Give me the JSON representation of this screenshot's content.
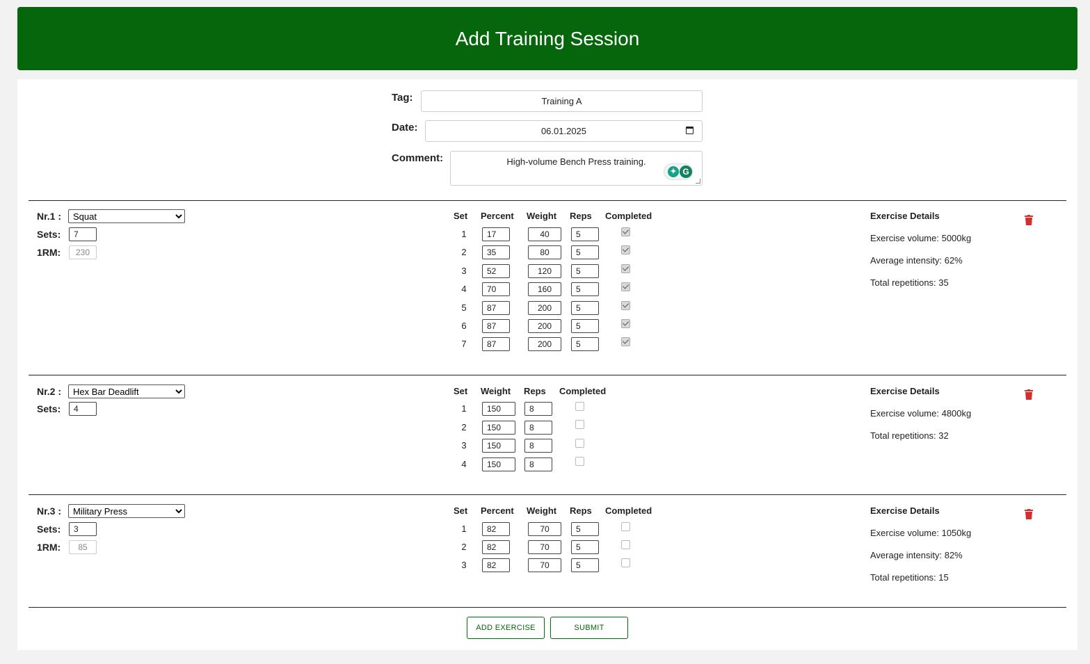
{
  "header": {
    "title": "Add Training Session"
  },
  "form": {
    "tag_label": "Tag:",
    "tag_value": "Training A",
    "date_label": "Date:",
    "date_value": "06.01.2025",
    "comment_label": "Comment:",
    "comment_value": "High-volume Bench Press training."
  },
  "exercises": [
    {
      "nr_label": "Nr.1 :",
      "name": "Squat",
      "sets_label": "Sets:",
      "sets": "7",
      "orm_label": "1RM:",
      "orm": "230",
      "headers": [
        "Set",
        "Percent",
        "Weight",
        "Reps",
        "Completed"
      ],
      "rows": [
        {
          "set": "1",
          "percent": "17",
          "weight": "40",
          "reps": "5",
          "completed": true
        },
        {
          "set": "2",
          "percent": "35",
          "weight": "80",
          "reps": "5",
          "completed": true
        },
        {
          "set": "3",
          "percent": "52",
          "weight": "120",
          "reps": "5",
          "completed": true
        },
        {
          "set": "4",
          "percent": "70",
          "weight": "160",
          "reps": "5",
          "completed": true
        },
        {
          "set": "5",
          "percent": "87",
          "weight": "200",
          "reps": "5",
          "completed": true
        },
        {
          "set": "6",
          "percent": "87",
          "weight": "200",
          "reps": "5",
          "completed": true
        },
        {
          "set": "7",
          "percent": "87",
          "weight": "200",
          "reps": "5",
          "completed": true
        }
      ],
      "details_title": "Exercise Details",
      "details": [
        "Exercise volume: 5000kg",
        "Average intensity: 62%",
        "Total repetitions: 35"
      ]
    },
    {
      "nr_label": "Nr.2 :",
      "name": "Hex Bar Deadlift",
      "sets_label": "Sets:",
      "sets": "4",
      "headers": [
        "Set",
        "Weight",
        "Reps",
        "Completed"
      ],
      "rows": [
        {
          "set": "1",
          "weight": "150",
          "reps": "8",
          "completed": false
        },
        {
          "set": "2",
          "weight": "150",
          "reps": "8",
          "completed": false
        },
        {
          "set": "3",
          "weight": "150",
          "reps": "8",
          "completed": false
        },
        {
          "set": "4",
          "weight": "150",
          "reps": "8",
          "completed": false
        }
      ],
      "details_title": "Exercise Details",
      "details": [
        "Exercise volume: 4800kg",
        "Total repetitions: 32"
      ]
    },
    {
      "nr_label": "Nr.3 :",
      "name": "Military Press",
      "sets_label": "Sets:",
      "sets": "3",
      "orm_label": "1RM:",
      "orm": "85",
      "headers": [
        "Set",
        "Percent",
        "Weight",
        "Reps",
        "Completed"
      ],
      "rows": [
        {
          "set": "1",
          "percent": "82",
          "weight": "70",
          "reps": "5",
          "completed": false
        },
        {
          "set": "2",
          "percent": "82",
          "weight": "70",
          "reps": "5",
          "completed": false
        },
        {
          "set": "3",
          "percent": "82",
          "weight": "70",
          "reps": "5",
          "completed": false
        }
      ],
      "details_title": "Exercise Details",
      "details": [
        "Exercise volume: 1050kg",
        "Average intensity: 82%",
        "Total repetitions: 15"
      ]
    }
  ],
  "actions": {
    "add_label": "ADD EXERCISE",
    "submit_label": "SUBMIT"
  },
  "colors": {
    "header_bg": "#05660b",
    "accent": "#05660b",
    "delete": "#d32f2f"
  },
  "icons": {
    "delete": "trash-icon",
    "date": "calendar-icon",
    "grammarly": "grammarly-icon"
  }
}
